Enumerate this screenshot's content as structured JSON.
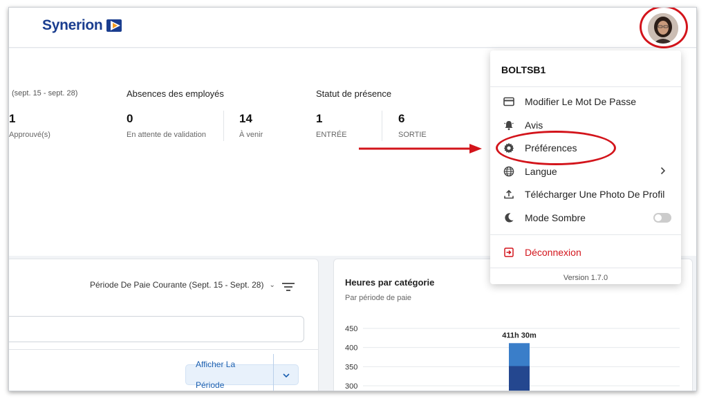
{
  "app": {
    "brand": "Synerion",
    "colors": {
      "brand": "#1a3d8f",
      "accent": "#1b5fb0",
      "danger": "#d3141b",
      "bar_top": "#3a7ec9",
      "bar_bottom": "#24478f"
    }
  },
  "stats": {
    "period_range": "(sept. 15 - sept. 28)",
    "approved_count": "1",
    "approved_label": "Approuvé(s)",
    "absences_title": "Absences des employés",
    "pending_count": "0",
    "pending_label": "En attente de validation",
    "upcoming_count": "14",
    "upcoming_label": "À venir",
    "presence_title": "Statut de présence",
    "in_count": "1",
    "in_label": "ENTRÉE",
    "out_count": "6",
    "out_label": "SORTIE"
  },
  "timesheet_panel": {
    "period_select": "Période De Paie Courante (Sept. 15 - Sept. 28)",
    "show_period_button": "Afficher La Période"
  },
  "chart_panel": {
    "title": "Heures par catégorie",
    "subtitle": "Par période de paie"
  },
  "chart_data": {
    "type": "bar",
    "title": "Heures par catégorie",
    "subtitle": "Par période de paie",
    "y_ticks": [
      "450",
      "400",
      "350",
      "300"
    ],
    "ylim": [
      280,
      460
    ],
    "bar_total_label": "411h 30m",
    "series": [
      {
        "name": "",
        "values": [
          351.5
        ]
      },
      {
        "name": "",
        "values": [
          60
        ]
      }
    ],
    "stack_total": 411.5,
    "grid": true
  },
  "user_menu": {
    "username": "BOLTSB1",
    "items": [
      {
        "label": "Modifier Le Mot De Passe",
        "icon": "credit-card-icon"
      },
      {
        "label": "Avis",
        "icon": "bell-icon"
      },
      {
        "label": "Préférences",
        "icon": "gear-icon"
      },
      {
        "label": "Langue",
        "icon": "globe-icon"
      },
      {
        "label": "Télécharger Une Photo De Profil",
        "icon": "upload-icon"
      },
      {
        "label": "Mode Sombre",
        "icon": "moon-icon"
      }
    ],
    "logout": "Déconnexion",
    "version": "Version 1.7.0"
  }
}
